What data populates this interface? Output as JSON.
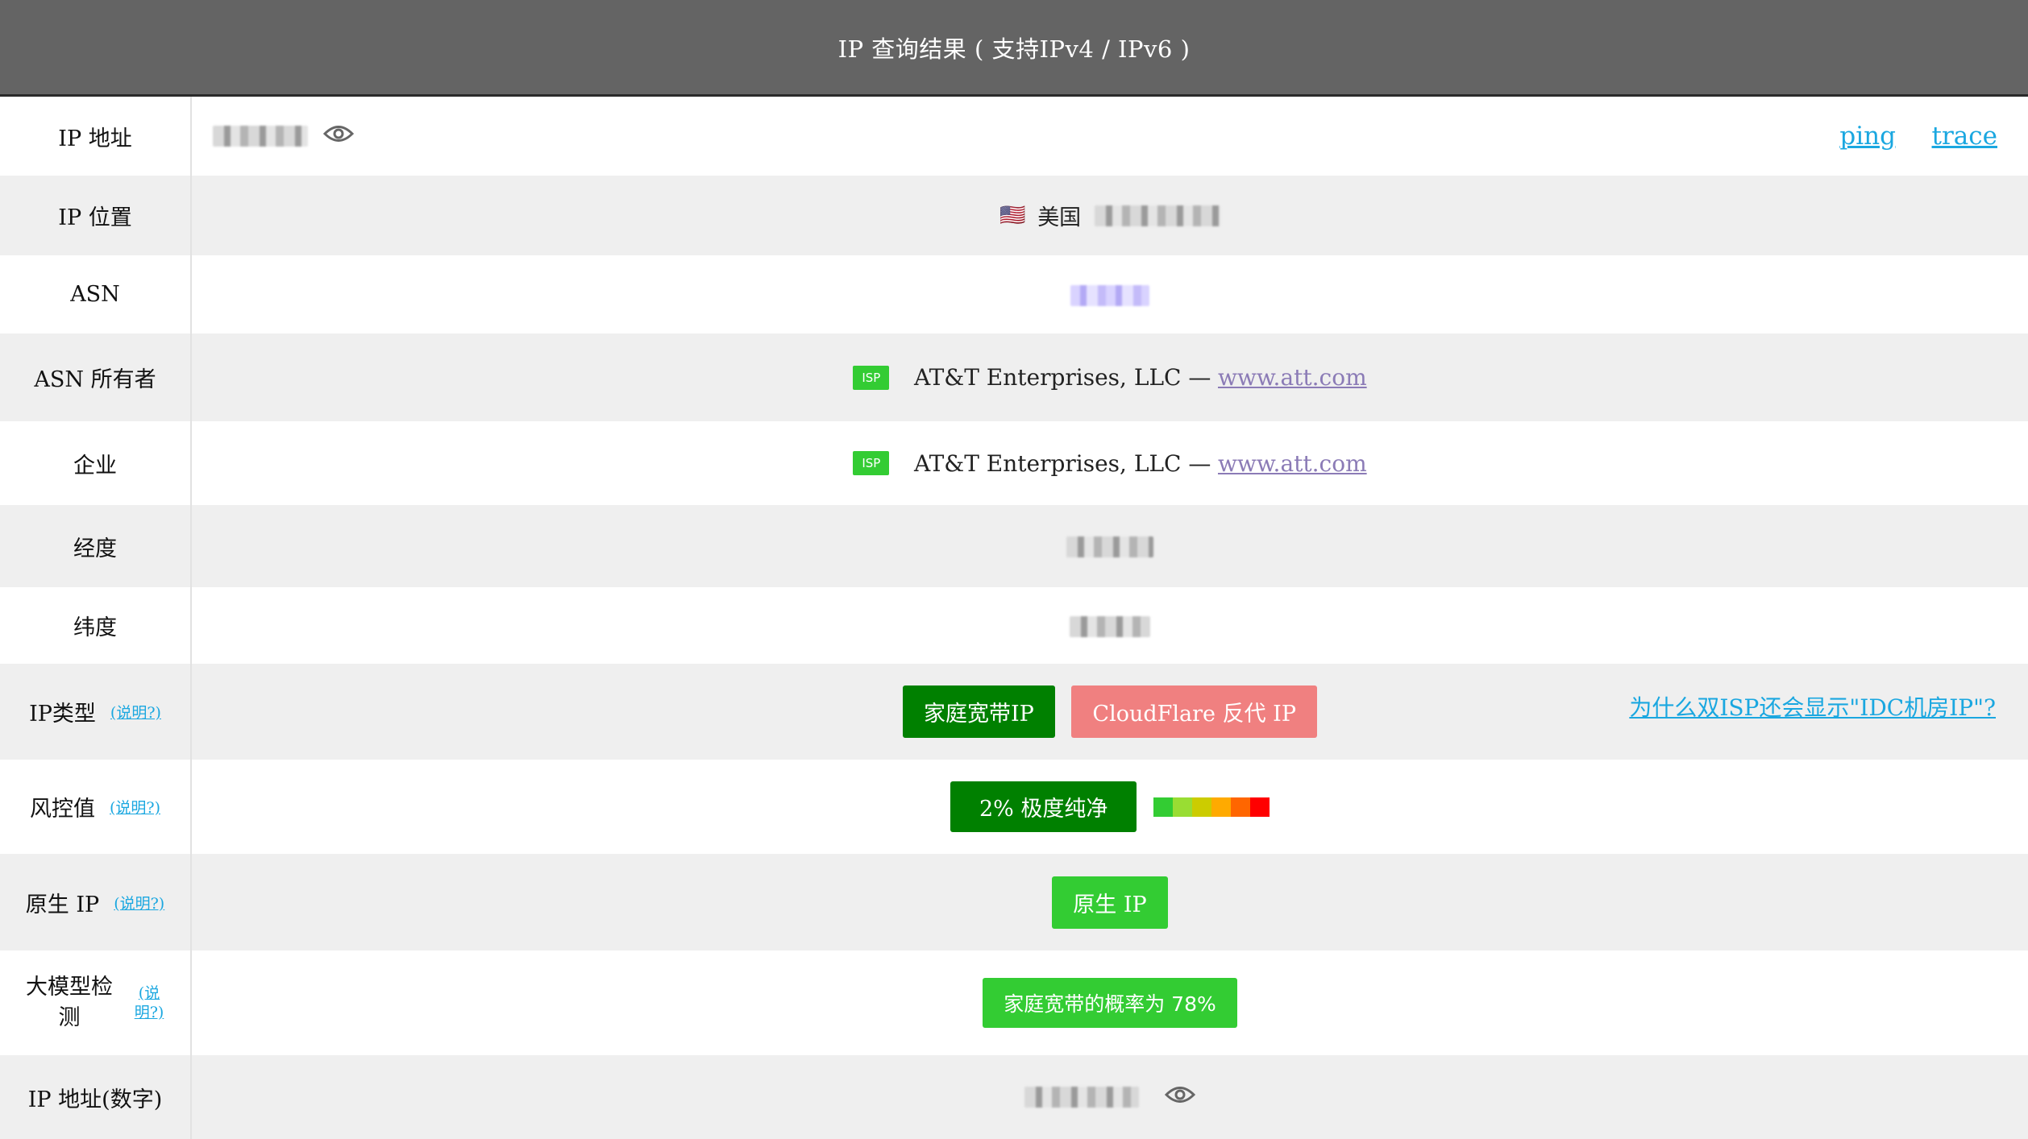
{
  "header": {
    "title": "IP 查询结果 ( 支持IPv4 / IPv6 )"
  },
  "rows": {
    "ip_address": {
      "label": "IP 地址",
      "ping": "ping",
      "trace": "trace"
    },
    "ip_location": {
      "label": "IP 位置",
      "flag": "🇺🇸",
      "country": "美国"
    },
    "asn": {
      "label": "ASN"
    },
    "asn_owner": {
      "label": "ASN 所有者",
      "badge": "ISP",
      "name": "AT&T Enterprises, LLC —",
      "site": "www.att.com"
    },
    "company": {
      "label": "企业",
      "badge": "ISP",
      "name": "AT&T Enterprises, LLC —",
      "site": "www.att.com"
    },
    "longitude": {
      "label": "经度"
    },
    "latitude": {
      "label": "纬度"
    },
    "ip_type": {
      "label": "IP类型",
      "note": "(说明?)",
      "tag1": "家庭宽带IP",
      "tag2": "CloudFlare 反代 IP",
      "why_link": "为什么双ISP还会显示\"IDC机房IP\"?"
    },
    "risk": {
      "label": "风控值",
      "note": "(说明?)",
      "value": "2%   极度纯净",
      "meter_colors": [
        "#33cc33",
        "#99dd33",
        "#cccc00",
        "#ffaa00",
        "#ff6600",
        "#ff0000"
      ]
    },
    "native_ip": {
      "label": "原生 IP",
      "note": "(说明?)",
      "value": "原生 IP"
    },
    "llm_detect": {
      "label": "大模型检测",
      "note": "(说明?)",
      "value": "家庭宽带的概率为 78%"
    },
    "ip_numeric": {
      "label": "IP 地址(数字)"
    }
  }
}
